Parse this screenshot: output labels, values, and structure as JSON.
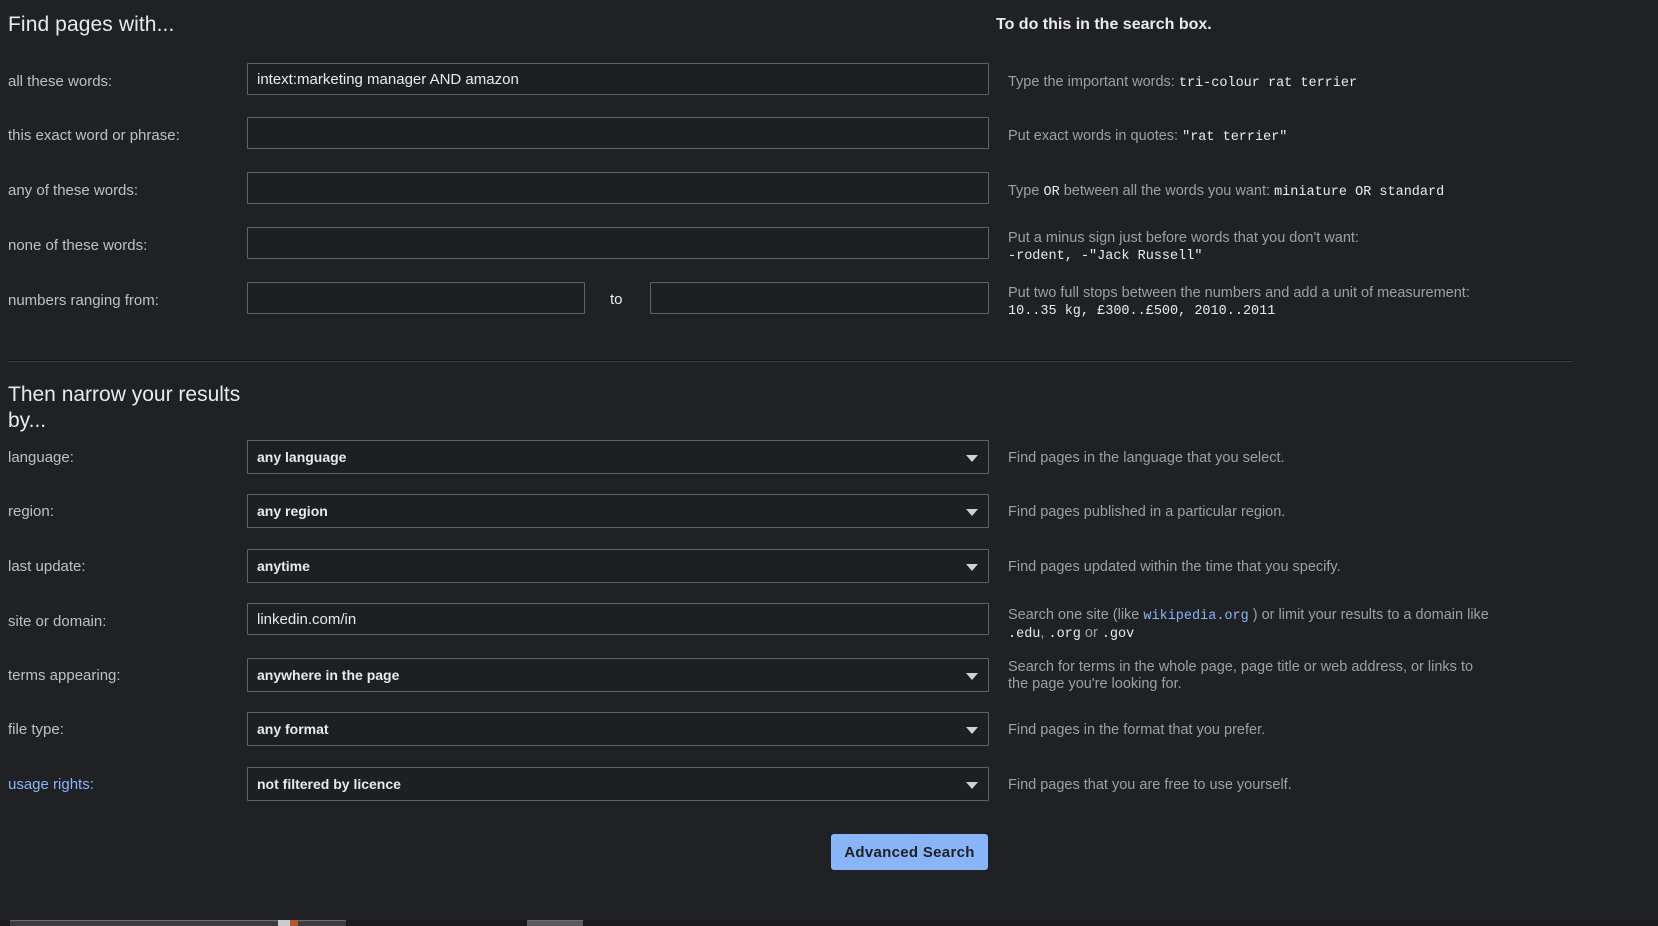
{
  "headings": {
    "find_pages_with": "Find pages with...",
    "to_do_this": "To do this in the search box.",
    "then_narrow": "Then narrow your results by..."
  },
  "find_rows": {
    "all_words": {
      "label": "all these words:",
      "value": "intext:marketing manager AND amazon",
      "hint_prefix": "Type the important words: ",
      "hint_code": "tri-colour rat terrier"
    },
    "exact_phrase": {
      "label": "this exact word or phrase:",
      "value": "",
      "hint_prefix": "Put exact words in quotes: ",
      "hint_code": "\"rat terrier\""
    },
    "any_words": {
      "label": "any of these words:",
      "value": "",
      "hint_a": "Type ",
      "hint_code_a": "OR",
      "hint_b": " between all the words you want: ",
      "hint_code_b": "miniature OR standard"
    },
    "none_words": {
      "label": "none of these words:",
      "value": "",
      "hint_prefix": "Put a minus sign just before words that you don't want:",
      "hint_code": "-rodent, -\"Jack Russell\""
    },
    "numbers": {
      "label": "numbers ranging from:",
      "from_value": "",
      "to_word": "to",
      "to_value": "",
      "hint_prefix": "Put two full stops between the numbers and add a unit of measurement:",
      "hint_code": "10..35 kg, £300..£500, 2010..2011"
    }
  },
  "narrow_rows": {
    "language": {
      "label": "language:",
      "value": "any language",
      "hint": "Find pages in the language that you select."
    },
    "region": {
      "label": "region:",
      "value": "any region",
      "hint": "Find pages published in a particular region."
    },
    "last_update": {
      "label": "last update:",
      "value": "anytime",
      "hint": "Find pages updated within the time that you specify."
    },
    "site_domain": {
      "label": "site or domain:",
      "value": "linkedin.com/in",
      "hint_a": "Search one site (like ",
      "hint_code_a": "wikipedia.org",
      "hint_b": " ) or limit your results to a domain like",
      "hint_code_b": ".edu",
      "hint_c": ", ",
      "hint_code_c": ".org",
      "hint_d": " or ",
      "hint_code_d": ".gov"
    },
    "terms_appearing": {
      "label": "terms appearing:",
      "value": "anywhere in the page",
      "hint": "Search for terms in the whole page, page title or web address, or links to the page you're looking for."
    },
    "file_type": {
      "label": "file type:",
      "value": "any format",
      "hint": "Find pages in the format that you prefer."
    },
    "usage_rights": {
      "label": "usage rights:",
      "value": "not filtered by licence",
      "hint": "Find pages that you are free to use yourself."
    }
  },
  "actions": {
    "advanced_search": "Advanced Search"
  },
  "colors": {
    "page_bg": "#202124",
    "field_bg": "#1d1f21",
    "field_border": "#5f6368",
    "text_primary": "#e8eaed",
    "text_secondary": "#bdc1c6",
    "hint_text": "#9aa0a6",
    "accent_link": "#8ab4f8",
    "button_bg": "#8ab4f8",
    "button_text": "#202124"
  }
}
